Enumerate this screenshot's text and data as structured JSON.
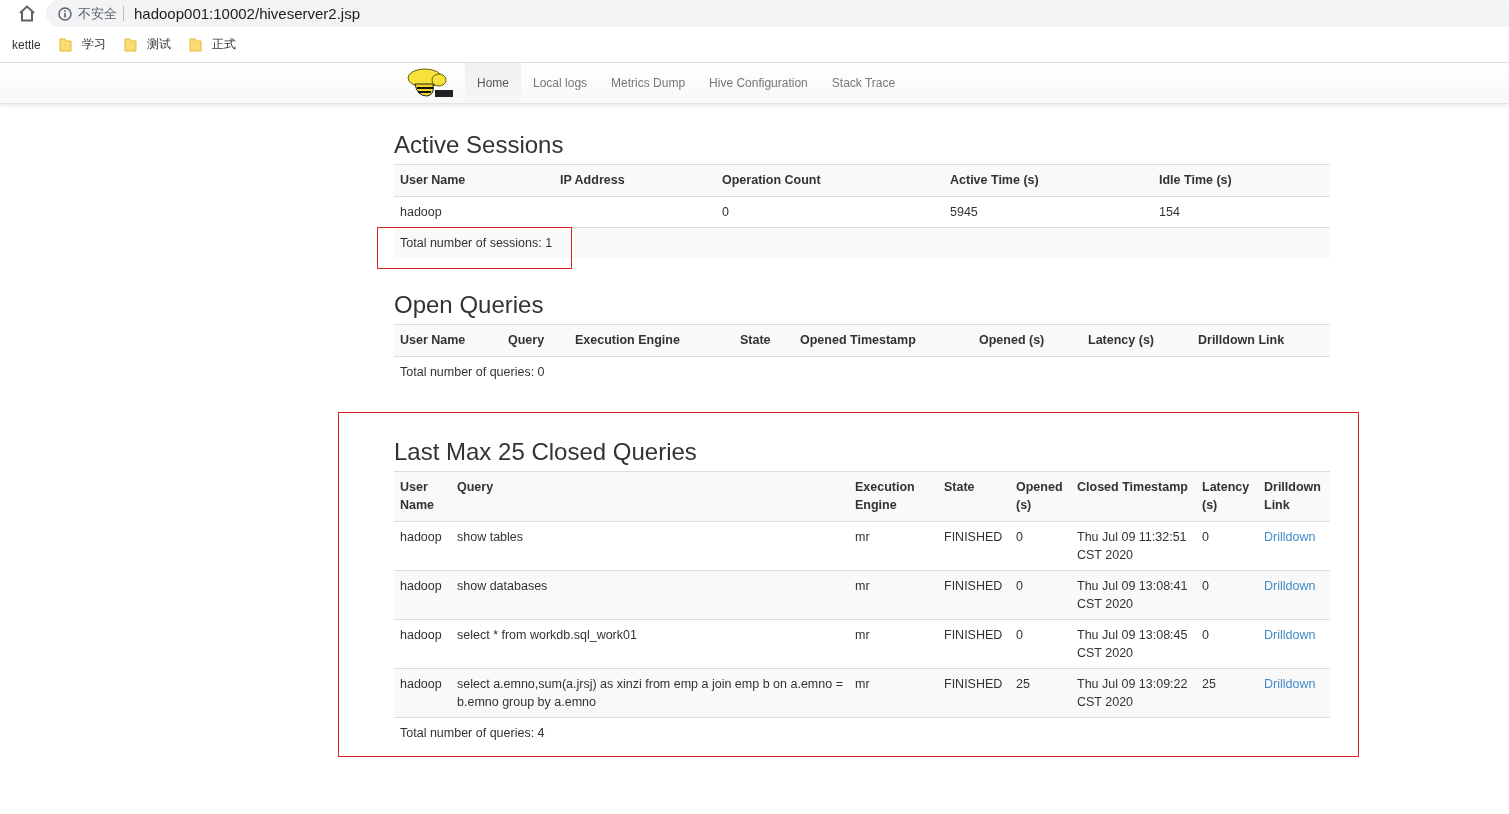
{
  "browser": {
    "security_label": "不安全",
    "url": "hadoop001:10002/hiveserver2.jsp",
    "bookmarks": [
      {
        "label": "kettle"
      },
      {
        "label": "学习"
      },
      {
        "label": "测试"
      },
      {
        "label": "正式"
      }
    ]
  },
  "nav": [
    {
      "label": "Home",
      "selected": true
    },
    {
      "label": "Local logs",
      "selected": false
    },
    {
      "label": "Metrics Dump",
      "selected": false
    },
    {
      "label": "Hive Configuration",
      "selected": false
    },
    {
      "label": "Stack Trace",
      "selected": false
    }
  ],
  "sections": [
    {
      "title": "Active Sessions",
      "footer_highlighted": true,
      "columns": [
        {
          "label": "User Name",
          "kind": "text"
        },
        {
          "label": "IP Address",
          "kind": "text"
        },
        {
          "label": "Operation Count",
          "kind": "text"
        },
        {
          "label": "Active Time (s)",
          "kind": "text"
        },
        {
          "label": "Idle Time (s)",
          "kind": "text"
        }
      ],
      "rows": [
        [
          "hadoop",
          null,
          "0",
          "5945",
          "154"
        ]
      ],
      "footer": "Total number of sessions: 1"
    },
    {
      "title": "Open Queries",
      "columns": [
        {
          "label": "User Name"
        },
        {
          "label": "Query"
        },
        {
          "label": "Execution Engine"
        },
        {
          "label": "State"
        },
        {
          "label": "Opened Timestamp"
        },
        {
          "label": "Opened (s)"
        },
        {
          "label": "Latency (s)"
        },
        {
          "label": "Drilldown Link"
        }
      ],
      "footer": "Total number of queries: 0"
    },
    {
      "title": "Last Max 25 Closed Queries",
      "highlighted": true,
      "columns": [
        {
          "label": "User Name",
          "kind": "text"
        },
        {
          "label": "Query",
          "kind": "text"
        },
        {
          "label": "Execution Engine",
          "kind": "text"
        },
        {
          "label": "State",
          "kind": "text"
        },
        {
          "label": "Opened (s)",
          "kind": "text"
        },
        {
          "label": "Closed Timestamp",
          "kind": "text"
        },
        {
          "label": "Latency (s)",
          "kind": "text"
        },
        {
          "label": "Drilldown Link",
          "kind": "link"
        }
      ],
      "rows": [
        [
          "hadoop",
          "show tables",
          "mr",
          "FINISHED",
          "0",
          "Thu Jul 09 11:32:51 CST 2020",
          "0",
          "Drilldown"
        ],
        [
          "hadoop",
          "show databases",
          "mr",
          "FINISHED",
          "0",
          "Thu Jul 09 13:08:41 CST 2020",
          "0",
          "Drilldown"
        ],
        [
          "hadoop",
          "select * from workdb.sql_work01",
          "mr",
          "FINISHED",
          "0",
          "Thu Jul 09 13:08:45 CST 2020",
          "0",
          "Drilldown"
        ],
        [
          "hadoop",
          "select a.emno,sum(a.jrsj) as xinzi from emp a  join emp b on a.emno = b.emno group by a.emno",
          "mr",
          "FINISHED",
          "25",
          "Thu Jul 09 13:09:22 CST 2020",
          "25",
          "Drilldown"
        ]
      ],
      "footer": "Total number of queries: 4"
    }
  ]
}
